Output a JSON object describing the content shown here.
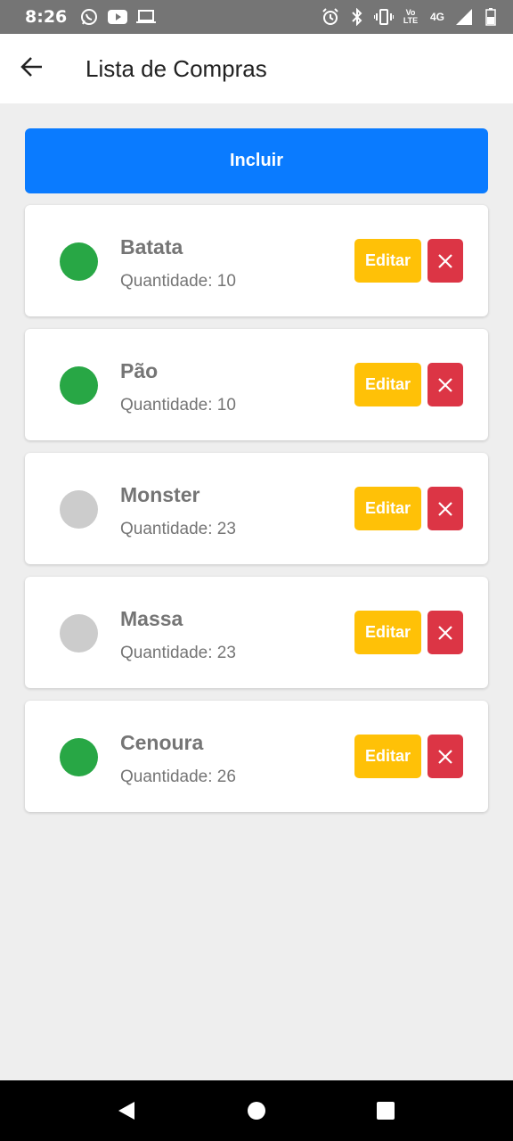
{
  "status_bar": {
    "time": "8:26",
    "left_icons": [
      "whatsapp-icon",
      "youtube-icon",
      "laptop-icon"
    ],
    "right_icons": [
      "alarm-icon",
      "bluetooth-icon",
      "vibrate-icon",
      "volte-icon",
      "network-4g-icon",
      "signal-icon",
      "battery-icon"
    ],
    "volte_label": "Vo LTE",
    "network_label": "4G"
  },
  "app_bar": {
    "title": "Lista de Compras",
    "back_icon": "arrow-left-icon"
  },
  "include_button": {
    "label": "Incluir",
    "color": "#0a7bff"
  },
  "items": [
    {
      "name": "Batata",
      "quantity": "Quantidade: 10",
      "status": "active",
      "dot_color": "#28a745",
      "edit_label": "Editar"
    },
    {
      "name": "Pão",
      "quantity": "Quantidade: 10",
      "status": "active",
      "dot_color": "#28a745",
      "edit_label": "Editar"
    },
    {
      "name": "Monster",
      "quantity": "Quantidade: 23",
      "status": "inactive",
      "dot_color": "#cccccc",
      "edit_label": "Editar"
    },
    {
      "name": "Massa",
      "quantity": "Quantidade: 23",
      "status": "inactive",
      "dot_color": "#cccccc",
      "edit_label": "Editar"
    },
    {
      "name": "Cenoura",
      "quantity": "Quantidade: 26",
      "status": "active",
      "dot_color": "#28a745",
      "edit_label": "Editar"
    }
  ],
  "colors": {
    "edit": "#ffc107",
    "delete": "#dc3545",
    "background": "#eeeeee"
  },
  "nav_bar": {
    "icons": [
      "back-triangle-icon",
      "home-circle-icon",
      "recents-square-icon"
    ]
  }
}
